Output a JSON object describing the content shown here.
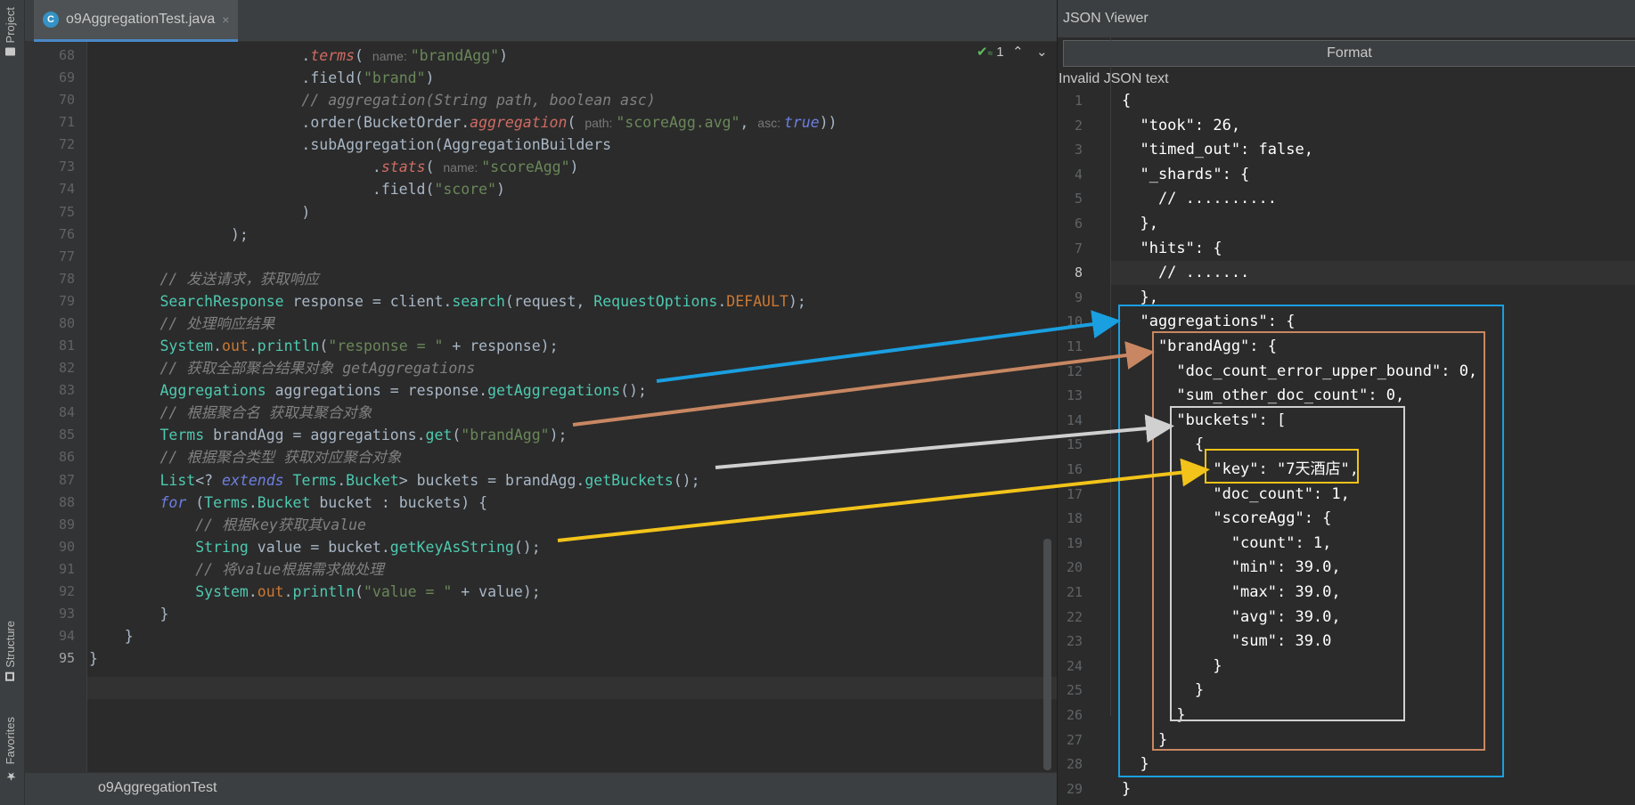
{
  "sidebar": {
    "project": "Project",
    "structure": "Structure",
    "favorites": "Favorites"
  },
  "tab": {
    "filename": "o9AggregationTest.java",
    "close": "×"
  },
  "inspection": {
    "count": "1",
    "up": "⌃",
    "down": "⌄"
  },
  "status": {
    "breadcrumb": "o9AggregationTest"
  },
  "code": {
    "lines": [
      {
        "n": "68",
        "html": "                        .<span class='method'>terms</span>( <span class='hint'>name: </span><span class='st'>\"brandAgg\"</span>)"
      },
      {
        "n": "69",
        "html": "                        .field(<span class='st'>\"brand\"</span>)"
      },
      {
        "n": "70",
        "html": "                        <span class='cm'>// aggregation(String path, boolean asc)</span>"
      },
      {
        "n": "71",
        "html": "                        .order(BucketOrder.<span class='method'>aggregation</span>( <span class='hint'>path: </span><span class='st'>\"scoreAgg.avg\"</span>, <span class='hint'>asc: </span><span class='kw'>true</span>))"
      },
      {
        "n": "72",
        "html": "                        .subAggregation(AggregationBuilders"
      },
      {
        "n": "73",
        "html": "                                .<span class='method'>stats</span>( <span class='hint'>name: </span><span class='st'>\"scoreAgg\"</span>)"
      },
      {
        "n": "74",
        "html": "                                .field(<span class='st'>\"score\"</span>)"
      },
      {
        "n": "75",
        "html": "                        )"
      },
      {
        "n": "76",
        "html": "                );"
      },
      {
        "n": "77",
        "html": ""
      },
      {
        "n": "78",
        "html": "        <span class='cm'>// 发送请求，获取响应</span>"
      },
      {
        "n": "79",
        "html": "        <span class='gm'>SearchResponse</span> response = client.<span class='gm'>search</span>(request, <span class='gm'>RequestOptions</span>.<span class='rd'>DEFAULT</span>);"
      },
      {
        "n": "80",
        "html": "        <span class='cm'>// 处理响应结果</span>"
      },
      {
        "n": "81",
        "html": "        <span class='gm'>System</span>.<span class='rd'>out</span>.<span class='gm'>println</span>(<span class='st'>\"response = \"</span> + response);"
      },
      {
        "n": "82",
        "html": "        <span class='cm'>// 获取全部聚合结果对象 getAggregations</span>"
      },
      {
        "n": "83",
        "html": "        <span class='gm'>Aggregations</span> aggregations = response.<span class='gm'>getAggregations</span>();"
      },
      {
        "n": "84",
        "html": "        <span class='cm'>// 根据聚合名 获取其聚合对象</span>"
      },
      {
        "n": "85",
        "html": "        <span class='gm'>Terms</span> brandAgg = aggregations.<span class='gm'>get</span>(<span class='st'>\"brandAgg\"</span>);"
      },
      {
        "n": "86",
        "html": "        <span class='cm'>// 根据聚合类型 获取对应聚合对象</span>"
      },
      {
        "n": "87",
        "html": "        <span class='gm'>List</span>&lt;? <span class='kw'>extends</span> <span class='gm'>Terms</span>.<span class='gm'>Bucket</span>&gt; buckets = brandAgg.<span class='gm'>getBuckets</span>();"
      },
      {
        "n": "88",
        "html": "        <span class='kw'>for</span> (<span class='gm'>Terms</span>.<span class='gm'>Bucket</span> bucket : buckets) {"
      },
      {
        "n": "89",
        "html": "            <span class='cm'>// 根据key获取其value</span>"
      },
      {
        "n": "90",
        "html": "            <span class='gm'>String</span> value = bucket.<span class='gm'>getKeyAsString</span>();"
      },
      {
        "n": "91",
        "html": "            <span class='cm'>// 将value根据需求做处理</span>"
      },
      {
        "n": "92",
        "html": "            <span class='gm'>System</span>.<span class='rd'>out</span>.<span class='gm'>println</span>(<span class='st'>\"value = \"</span> + value);"
      },
      {
        "n": "93",
        "html": "        }"
      },
      {
        "n": "94",
        "html": "    }"
      },
      {
        "n": "95",
        "html": "}"
      }
    ]
  },
  "json_viewer": {
    "title": "JSON Viewer",
    "format_button": "Format",
    "status": "Invalid JSON text",
    "lines": [
      {
        "n": "1",
        "t": "{"
      },
      {
        "n": "2",
        "t": "  \"took\": 26,"
      },
      {
        "n": "3",
        "t": "  \"timed_out\": false,"
      },
      {
        "n": "4",
        "t": "  \"_shards\": {"
      },
      {
        "n": "5",
        "t": "    // .........."
      },
      {
        "n": "6",
        "t": "  },"
      },
      {
        "n": "7",
        "t": "  \"hits\": {"
      },
      {
        "n": "8",
        "t": "    // ......."
      },
      {
        "n": "9",
        "t": "  },"
      },
      {
        "n": "10",
        "t": "  \"aggregations\": {"
      },
      {
        "n": "11",
        "t": "    \"brandAgg\": {"
      },
      {
        "n": "12",
        "t": "      \"doc_count_error_upper_bound\": 0,"
      },
      {
        "n": "13",
        "t": "      \"sum_other_doc_count\": 0,"
      },
      {
        "n": "14",
        "t": "      \"buckets\": ["
      },
      {
        "n": "15",
        "t": "        {"
      },
      {
        "n": "16",
        "t": "          \"key\": \"7天酒店\","
      },
      {
        "n": "17",
        "t": "          \"doc_count\": 1,"
      },
      {
        "n": "18",
        "t": "          \"scoreAgg\": {"
      },
      {
        "n": "19",
        "t": "            \"count\": 1,"
      },
      {
        "n": "20",
        "t": "            \"min\": 39.0,"
      },
      {
        "n": "21",
        "t": "            \"max\": 39.0,"
      },
      {
        "n": "22",
        "t": "            \"avg\": 39.0,"
      },
      {
        "n": "23",
        "t": "            \"sum\": 39.0"
      },
      {
        "n": "24",
        "t": "          }"
      },
      {
        "n": "25",
        "t": "        }"
      },
      {
        "n": "26",
        "t": "      }"
      },
      {
        "n": "27",
        "t": "    }"
      },
      {
        "n": "28",
        "t": "  }"
      },
      {
        "n": "29",
        "t": "}"
      }
    ]
  },
  "colors": {
    "blue": "#1a9fe0",
    "orange": "#c88762",
    "gray": "#d0d0d0",
    "yellow": "#f2c31a"
  }
}
